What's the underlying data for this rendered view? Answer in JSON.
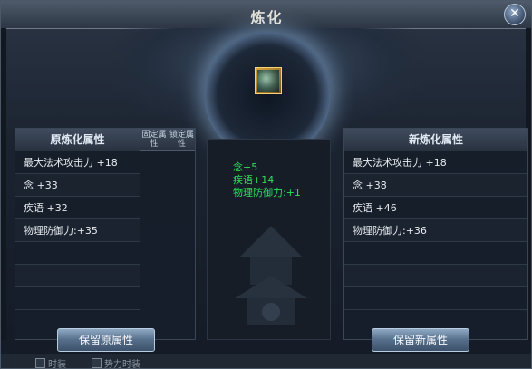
{
  "window": {
    "title": "炼化",
    "close_glyph": "✕"
  },
  "left_panel": {
    "header": "原炼化属性",
    "col_fixed": "固定属性",
    "col_locked": "锁定属性",
    "rows": [
      "最大法术攻击力 +18",
      "念 +33",
      "疾语 +32",
      "物理防御力:+35",
      "",
      "",
      ""
    ]
  },
  "right_panel": {
    "header": "新炼化属性",
    "rows": [
      "最大法术攻击力 +18",
      "念 +38",
      "疾语 +46",
      "物理防御力:+36",
      "",
      "",
      ""
    ]
  },
  "middle": {
    "changes": [
      "念+5",
      "疾语+14",
      "物理防御力:+1"
    ]
  },
  "buttons": {
    "keep_old": "保留原属性",
    "keep_new": "保留新属性"
  },
  "bottom": {
    "opt1": "时装",
    "opt2": "势力时装"
  },
  "colors": {
    "change_text": "#2ee05a",
    "slot_border": "#d8a53b"
  },
  "icons": {
    "item_slot": "item-slot-icon",
    "close": "close-icon"
  }
}
